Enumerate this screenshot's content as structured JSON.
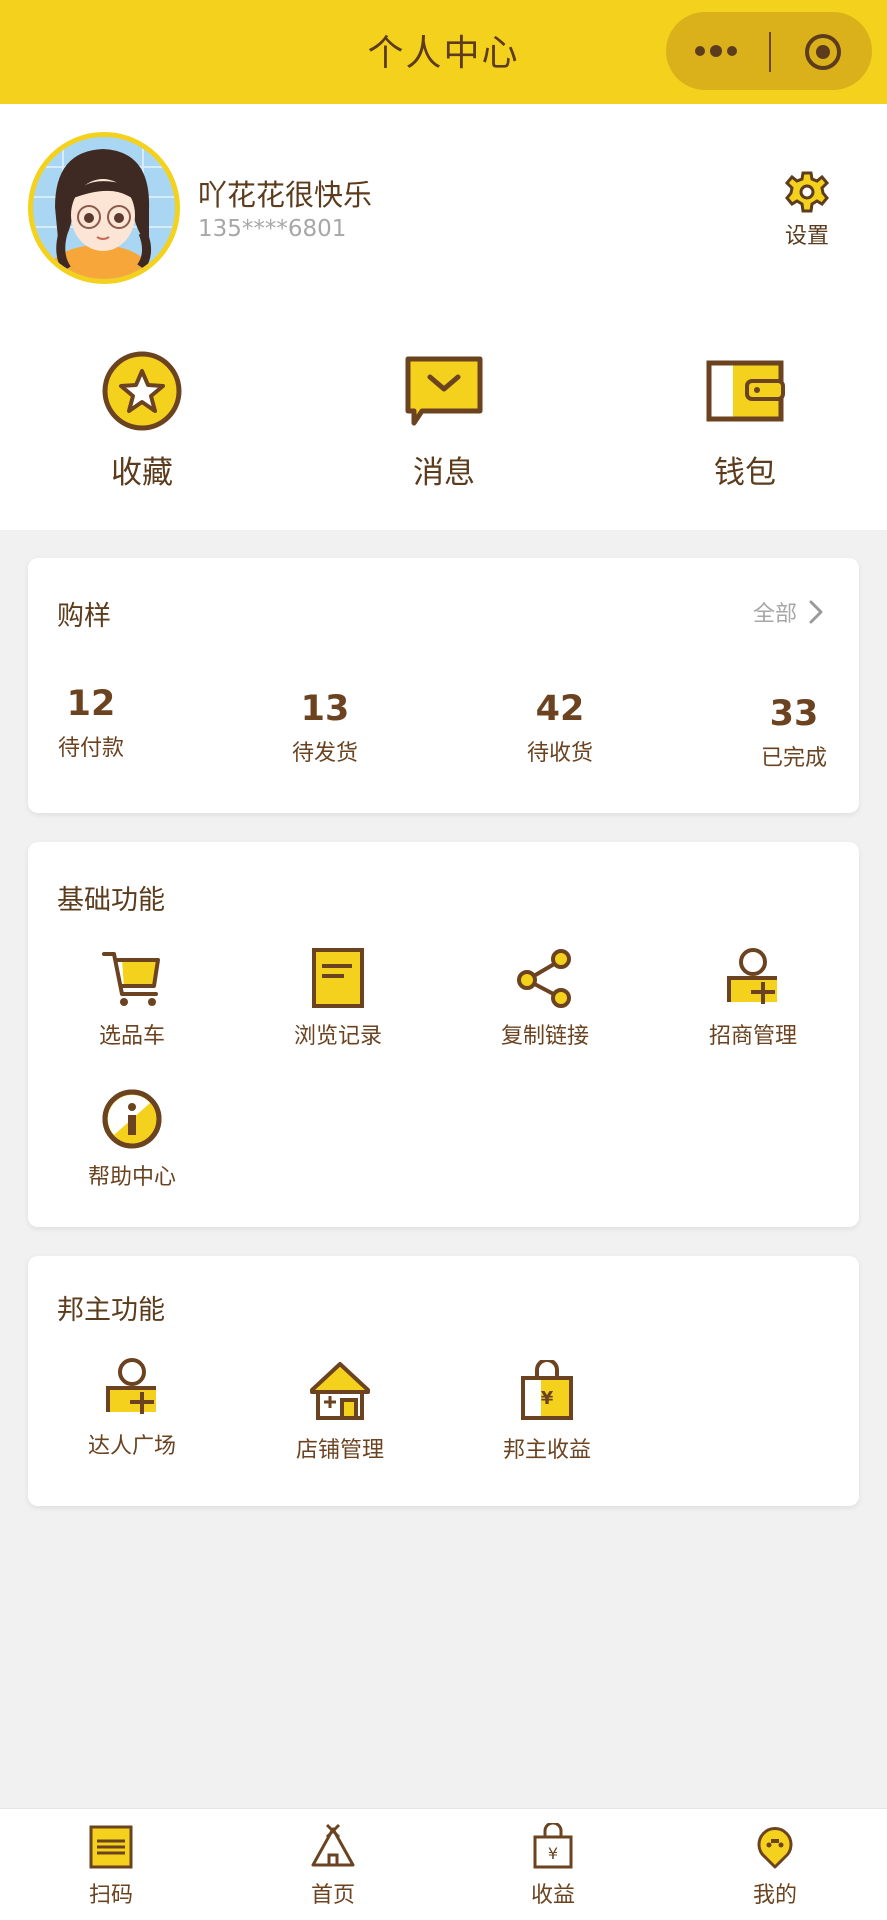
{
  "header": {
    "title": "个人中心"
  },
  "capsule": {
    "more_icon": "more-dots-icon",
    "close_icon": "target-icon"
  },
  "user": {
    "name": "吖花花很快乐",
    "phone": "135****6801"
  },
  "settings_label": "设置",
  "quick_actions": [
    {
      "label": "收藏",
      "icon": "star-icon"
    },
    {
      "label": "消息",
      "icon": "message-icon"
    },
    {
      "label": "钱包",
      "icon": "wallet-icon"
    }
  ],
  "orders": {
    "title": "购样",
    "see_all": "全部",
    "stats": [
      {
        "count": "12",
        "label": "待付款"
      },
      {
        "count": "13",
        "label": "待发货"
      },
      {
        "count": "42",
        "label": "待收货"
      },
      {
        "count": "33",
        "label": "已完成"
      }
    ]
  },
  "basic": {
    "title": "基础功能",
    "items": [
      {
        "label": "选品车",
        "icon": "cart-icon"
      },
      {
        "label": "浏览记录",
        "icon": "history-icon"
      },
      {
        "label": "复制链接",
        "icon": "share-icon"
      },
      {
        "label": "招商管理",
        "icon": "user-add-icon"
      },
      {
        "label": "帮助中心",
        "icon": "info-icon"
      }
    ]
  },
  "owner": {
    "title": "邦主功能",
    "items": [
      {
        "label": "达人广场",
        "icon": "user-add-icon"
      },
      {
        "label": "店铺管理",
        "icon": "store-icon"
      },
      {
        "label": "邦主收益",
        "icon": "money-bag-icon"
      }
    ]
  },
  "tabs": [
    {
      "label": "扫码",
      "icon": "scan-icon"
    },
    {
      "label": "首页",
      "icon": "tent-icon"
    },
    {
      "label": "收益",
      "icon": "earnings-icon"
    },
    {
      "label": "我的",
      "icon": "profile-icon"
    }
  ],
  "colors": {
    "accent": "#f4d11c",
    "brown": "#6b4320",
    "background": "#f1f1f1"
  }
}
